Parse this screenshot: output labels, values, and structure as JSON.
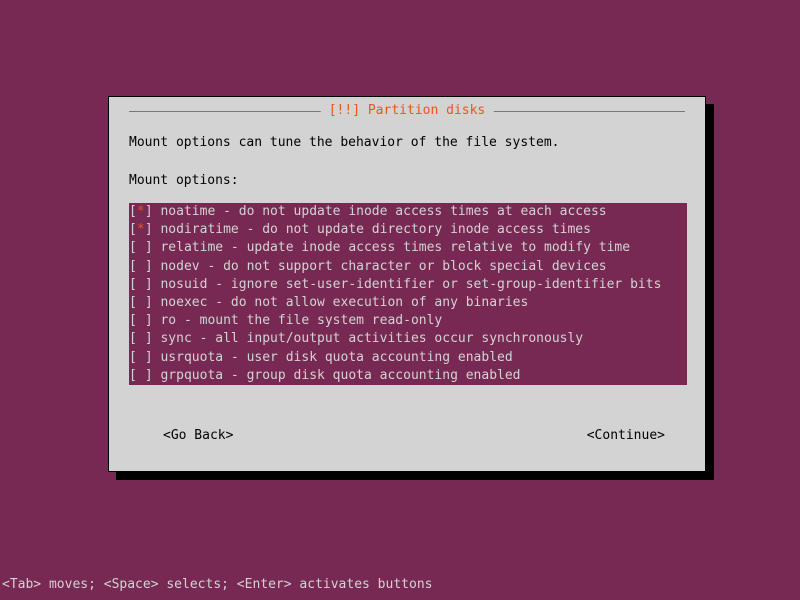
{
  "title": "[!!] Partition disks",
  "description": "Mount options can tune the behavior of the file system.",
  "label": "Mount options:",
  "options": [
    {
      "checked": true,
      "text": "noatime - do not update inode access times at each access"
    },
    {
      "checked": true,
      "text": "nodiratime - do not update directory inode access times"
    },
    {
      "checked": false,
      "text": "relatime - update inode access times relative to modify time"
    },
    {
      "checked": false,
      "text": "nodev - do not support character or block special devices"
    },
    {
      "checked": false,
      "text": "nosuid - ignore set-user-identifier or set-group-identifier bits"
    },
    {
      "checked": false,
      "text": "noexec - do not allow execution of any binaries"
    },
    {
      "checked": false,
      "text": "ro - mount the file system read-only"
    },
    {
      "checked": false,
      "text": "sync - all input/output activities occur synchronously"
    },
    {
      "checked": false,
      "text": "usrquota - user disk quota accounting enabled"
    },
    {
      "checked": false,
      "text": "grpquota - group disk quota accounting enabled"
    }
  ],
  "buttons": {
    "back": "<Go Back>",
    "continue": "<Continue>"
  },
  "hint": "<Tab> moves; <Space> selects; <Enter> activates buttons"
}
